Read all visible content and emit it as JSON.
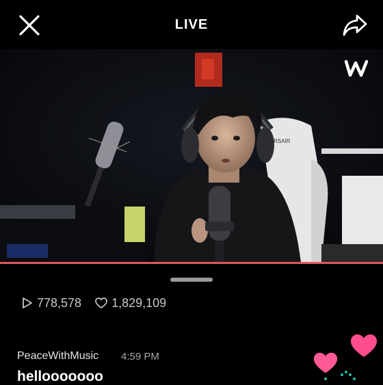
{
  "header": {
    "title": "LIVE"
  },
  "stats": {
    "plays": "778,578",
    "likes": "1,829,109"
  },
  "chat": {
    "username": "PeaceWithMusic",
    "time": "4:59 PM",
    "message": "hellooooooo"
  },
  "colors": {
    "accent": "#e0575f",
    "heart": "#ff4d8d"
  },
  "icons": [
    "close-icon",
    "share-icon",
    "weverse-logo-icon",
    "play-icon",
    "heart-outline-icon",
    "heart-icon"
  ]
}
